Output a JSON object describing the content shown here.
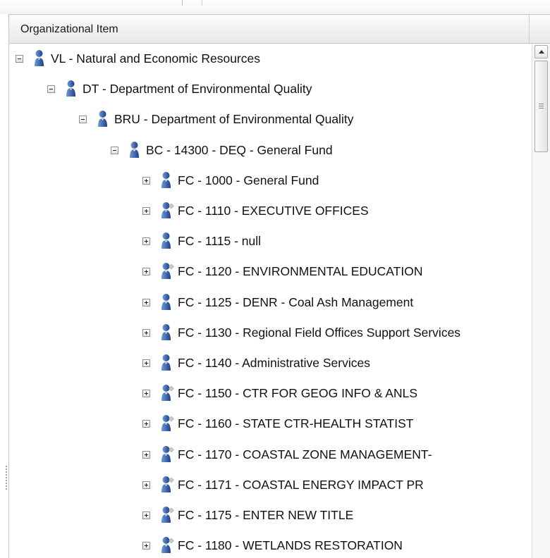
{
  "header": {
    "column_label": "Organizational Item"
  },
  "colors": {
    "person_dark": "#1d3f87",
    "person_light": "#6f9adb",
    "badge": "#c9c9c9"
  },
  "tree": [
    {
      "label": "VL - Natural and Economic Resources",
      "depth": 0,
      "expanded": true,
      "badge": false
    },
    {
      "label": "DT - Department of Environmental Quality",
      "depth": 1,
      "expanded": true,
      "badge": false
    },
    {
      "label": "BRU - Department of Environmental Quality",
      "depth": 2,
      "expanded": true,
      "badge": false
    },
    {
      "label": "BC - 14300 - DEQ - General Fund",
      "depth": 3,
      "expanded": true,
      "badge": false
    },
    {
      "label": "FC - 1000 - General Fund",
      "depth": 4,
      "expanded": false,
      "badge": false
    },
    {
      "label": "FC - 1110 - EXECUTIVE OFFICES",
      "depth": 4,
      "expanded": false,
      "badge": true
    },
    {
      "label": "FC - 1115 - null",
      "depth": 4,
      "expanded": false,
      "badge": false
    },
    {
      "label": "FC - 1120 - ENVIRONMENTAL EDUCATION",
      "depth": 4,
      "expanded": false,
      "badge": true
    },
    {
      "label": "FC - 1125 - DENR - Coal Ash Management",
      "depth": 4,
      "expanded": false,
      "badge": false
    },
    {
      "label": "FC - 1130 - Regional Field Offices Support Services",
      "depth": 4,
      "expanded": false,
      "badge": false
    },
    {
      "label": "FC - 1140 - Administrative Services",
      "depth": 4,
      "expanded": false,
      "badge": false
    },
    {
      "label": "FC - 1150 - CTR FOR GEOG INFO & ANLS",
      "depth": 4,
      "expanded": false,
      "badge": true
    },
    {
      "label": "FC - 1160 - STATE CTR-HEALTH STATIST",
      "depth": 4,
      "expanded": false,
      "badge": true
    },
    {
      "label": "FC - 1170 - COASTAL ZONE MANAGEMENT-",
      "depth": 4,
      "expanded": false,
      "badge": true
    },
    {
      "label": "FC - 1171 - COASTAL ENERGY IMPACT PR",
      "depth": 4,
      "expanded": false,
      "badge": true
    },
    {
      "label": "FC - 1175 - ENTER NEW TITLE",
      "depth": 4,
      "expanded": false,
      "badge": true
    },
    {
      "label": "FC - 1180 - WETLANDS RESTORATION",
      "depth": 4,
      "expanded": false,
      "badge": true
    }
  ]
}
